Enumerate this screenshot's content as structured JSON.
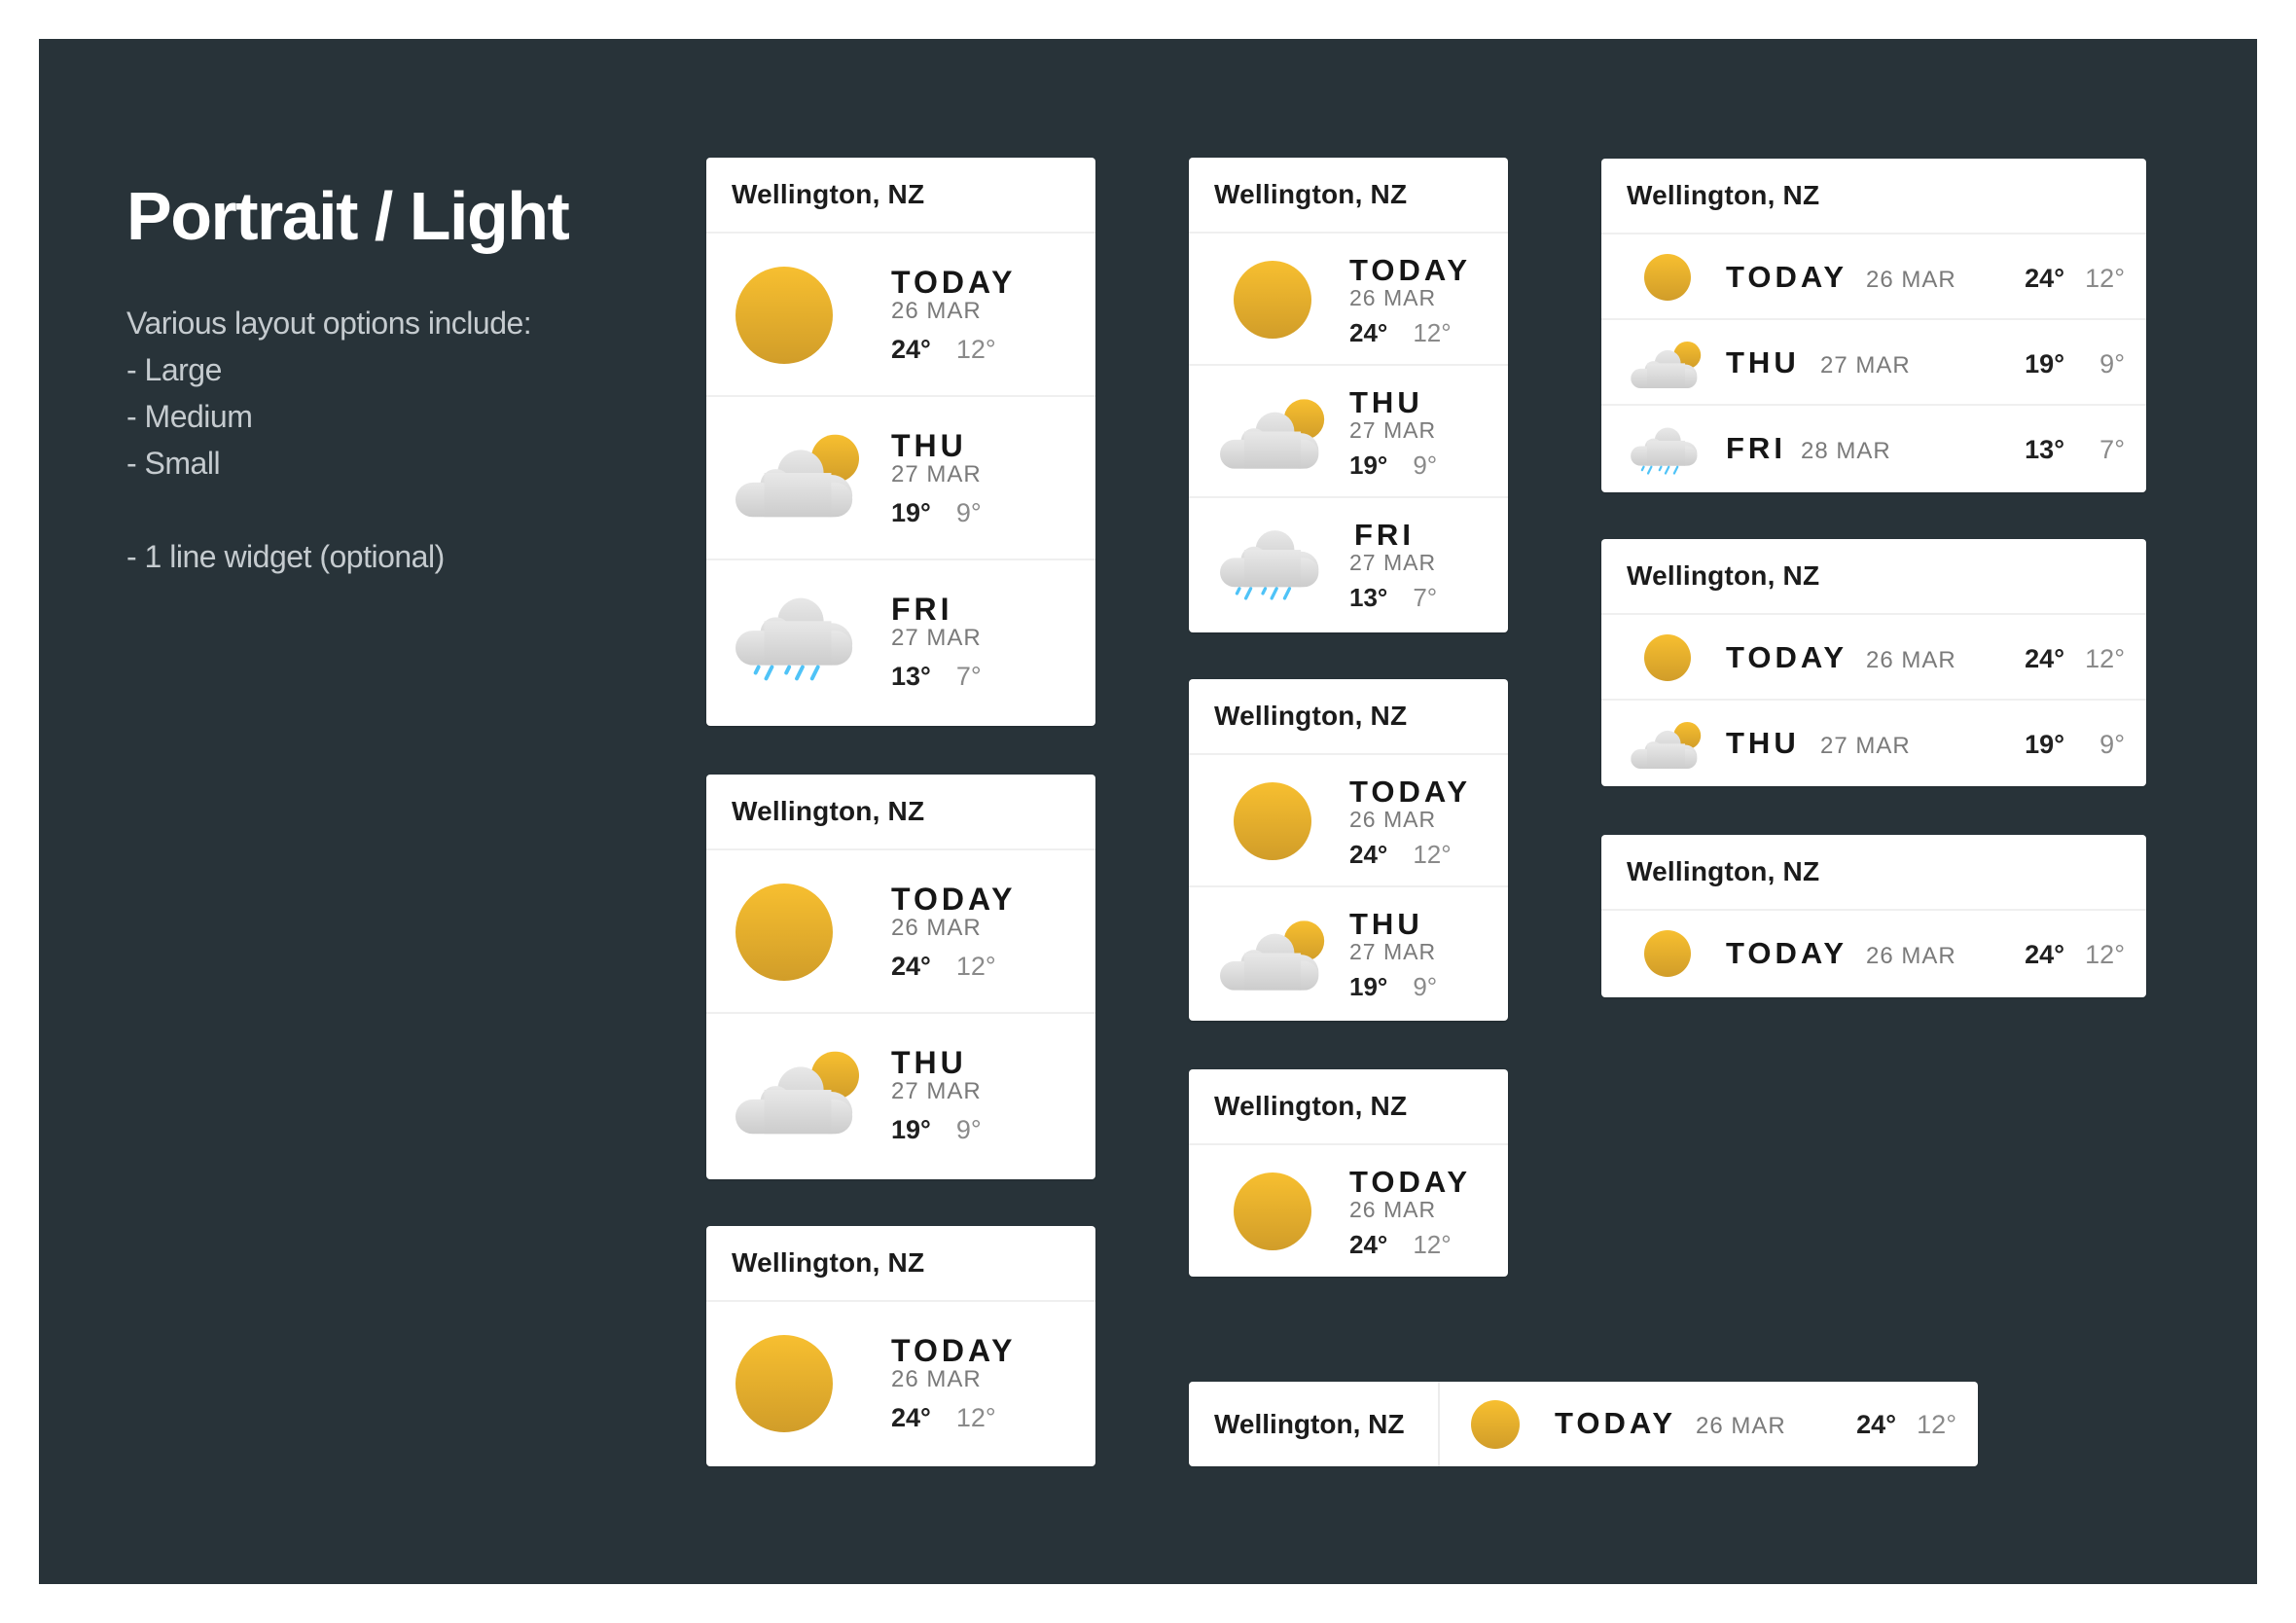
{
  "page": {
    "title": "Portrait / Light",
    "description_lines": [
      "Various layout options include:",
      "- Large",
      "- Medium",
      "- Small",
      "",
      "- 1 line widget (optional)"
    ]
  },
  "colors": {
    "background": "#283339",
    "card": "#ffffff",
    "sun_top": "#f7bf30",
    "sun_bottom": "#d19d29",
    "cloud_top": "#e8e8e8",
    "cloud_bottom": "#cccccc",
    "rain": "#4fc3f7",
    "primary_text": "#161616",
    "secondary_text": "#7a7a7a"
  },
  "widgets": {
    "large_3": {
      "location": "Wellington, NZ",
      "days": [
        {
          "day": "TODAY",
          "date": "26 MAR",
          "hi": "24°",
          "lo": "12°",
          "icon": "sun-icon"
        },
        {
          "day": "THU",
          "date": "27 MAR",
          "hi": "19°",
          "lo": "9°",
          "icon": "partly-cloudy-icon"
        },
        {
          "day": "FRI",
          "date": "27 MAR",
          "hi": "13°",
          "lo": "7°",
          "icon": "rain-cloud-icon"
        }
      ]
    },
    "large_2": {
      "location": "Wellington, NZ",
      "days": [
        {
          "day": "TODAY",
          "date": "26 MAR",
          "hi": "24°",
          "lo": "12°",
          "icon": "sun-icon"
        },
        {
          "day": "THU",
          "date": "27 MAR",
          "hi": "19°",
          "lo": "9°",
          "icon": "partly-cloudy-icon"
        }
      ]
    },
    "large_1": {
      "location": "Wellington, NZ",
      "days": [
        {
          "day": "TODAY",
          "date": "26 MAR",
          "hi": "24°",
          "lo": "12°",
          "icon": "sun-icon"
        }
      ]
    },
    "medium_3": {
      "location": "Wellington, NZ",
      "days": [
        {
          "day": "TODAY",
          "date": "26 MAR",
          "hi": "24°",
          "lo": "12°",
          "icon": "sun-icon"
        },
        {
          "day": "THU",
          "date": "27 MAR",
          "hi": "19°",
          "lo": "9°",
          "icon": "partly-cloudy-icon"
        },
        {
          "day": "FRI",
          "date": "27 MAR",
          "hi": "13°",
          "lo": "7°",
          "icon": "rain-cloud-icon"
        }
      ]
    },
    "medium_2": {
      "location": "Wellington, NZ",
      "days": [
        {
          "day": "TODAY",
          "date": "26 MAR",
          "hi": "24°",
          "lo": "12°",
          "icon": "sun-icon"
        },
        {
          "day": "THU",
          "date": "27 MAR",
          "hi": "19°",
          "lo": "9°",
          "icon": "partly-cloudy-icon"
        }
      ]
    },
    "medium_1": {
      "location": "Wellington, NZ",
      "days": [
        {
          "day": "TODAY",
          "date": "26 MAR",
          "hi": "24°",
          "lo": "12°",
          "icon": "sun-icon"
        }
      ]
    },
    "small_3": {
      "location": "Wellington, NZ",
      "days": [
        {
          "day": "TODAY",
          "date": "26 MAR",
          "hi": "24°",
          "lo": "12°",
          "icon": "sun-icon"
        },
        {
          "day": "THU",
          "date": "27 MAR",
          "hi": "19°",
          "lo": "9°",
          "icon": "partly-cloudy-icon"
        },
        {
          "day": "FRI",
          "date": "28 MAR",
          "hi": "13°",
          "lo": "7°",
          "icon": "rain-cloud-icon"
        }
      ]
    },
    "small_2": {
      "location": "Wellington, NZ",
      "days": [
        {
          "day": "TODAY",
          "date": "26 MAR",
          "hi": "24°",
          "lo": "12°",
          "icon": "sun-icon"
        },
        {
          "day": "THU",
          "date": "27 MAR",
          "hi": "19°",
          "lo": "9°",
          "icon": "partly-cloudy-icon"
        }
      ]
    },
    "small_1": {
      "location": "Wellington, NZ",
      "days": [
        {
          "day": "TODAY",
          "date": "26 MAR",
          "hi": "24°",
          "lo": "12°",
          "icon": "sun-icon"
        }
      ]
    },
    "one_line": {
      "location": "Wellington, NZ",
      "day": "TODAY",
      "date": "26 MAR",
      "hi": "24°",
      "lo": "12°",
      "icon": "sun-icon"
    }
  }
}
